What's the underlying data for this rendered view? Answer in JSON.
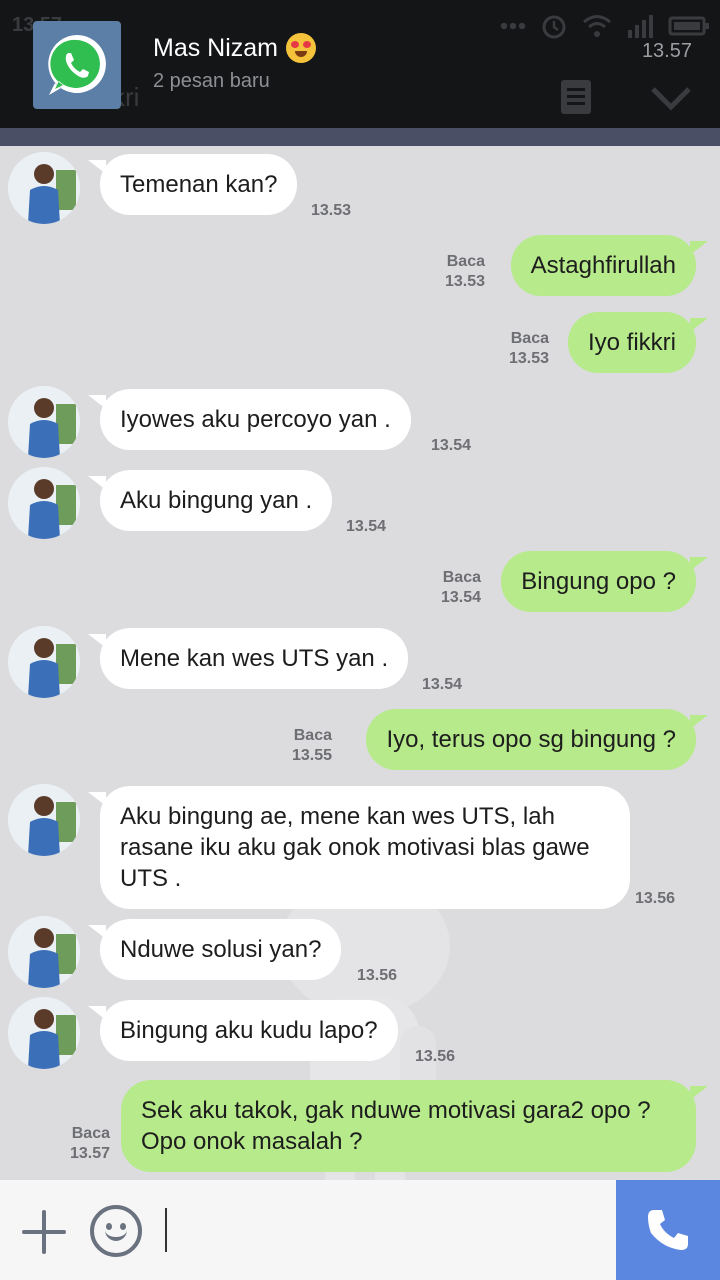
{
  "status": {
    "ghost_time": "13.57"
  },
  "notification": {
    "app_icon": "whatsapp-icon",
    "sender": "Mas Nizam",
    "emoji": "heart-eyes-emoji",
    "subtitle": "2 pesan baru",
    "time": "13.57",
    "ghost_chat_name": "kri"
  },
  "colors": {
    "header_bg": "#141517",
    "chat_bg": "#dcdcdf",
    "incoming_bubble": "#ffffff",
    "outgoing_bubble": "#b6ea8a",
    "call_button": "#5b87e0"
  },
  "messages": [
    {
      "dir": "in",
      "text": "Temenan kan?",
      "time": "13.53"
    },
    {
      "dir": "out",
      "text": "Astaghfirullah",
      "read": "Baca",
      "time": "13.53"
    },
    {
      "dir": "out",
      "text": "Iyo fikkri",
      "read": "Baca",
      "time": "13.53"
    },
    {
      "dir": "in",
      "text": "Iyowes aku percoyo yan .",
      "time": "13.54"
    },
    {
      "dir": "in",
      "text": "Aku bingung yan .",
      "time": "13.54"
    },
    {
      "dir": "out",
      "text": "Bingung opo ?",
      "read": "Baca",
      "time": "13.54"
    },
    {
      "dir": "in",
      "text": "Mene kan wes UTS yan .",
      "time": "13.54"
    },
    {
      "dir": "out",
      "text": "Iyo, terus opo sg bingung ?",
      "read": "Baca",
      "time": "13.55"
    },
    {
      "dir": "in",
      "text": "Aku bingung ae, mene kan wes UTS, lah rasane iku aku gak onok motivasi blas gawe UTS .",
      "time": "13.56"
    },
    {
      "dir": "in",
      "text": "Nduwe solusi yan?",
      "time": "13.56"
    },
    {
      "dir": "in",
      "text": "Bingung aku kudu lapo?",
      "time": "13.56"
    },
    {
      "dir": "out",
      "text": "Sek aku takok, gak nduwe motivasi gara2 opo ? Opo onok masalah ?",
      "read": "Baca",
      "time": "13.57"
    }
  ],
  "composer": {
    "add_icon": "plus-icon",
    "emoji_icon": "smiley-icon",
    "input_value": "",
    "call_icon": "phone-icon"
  }
}
